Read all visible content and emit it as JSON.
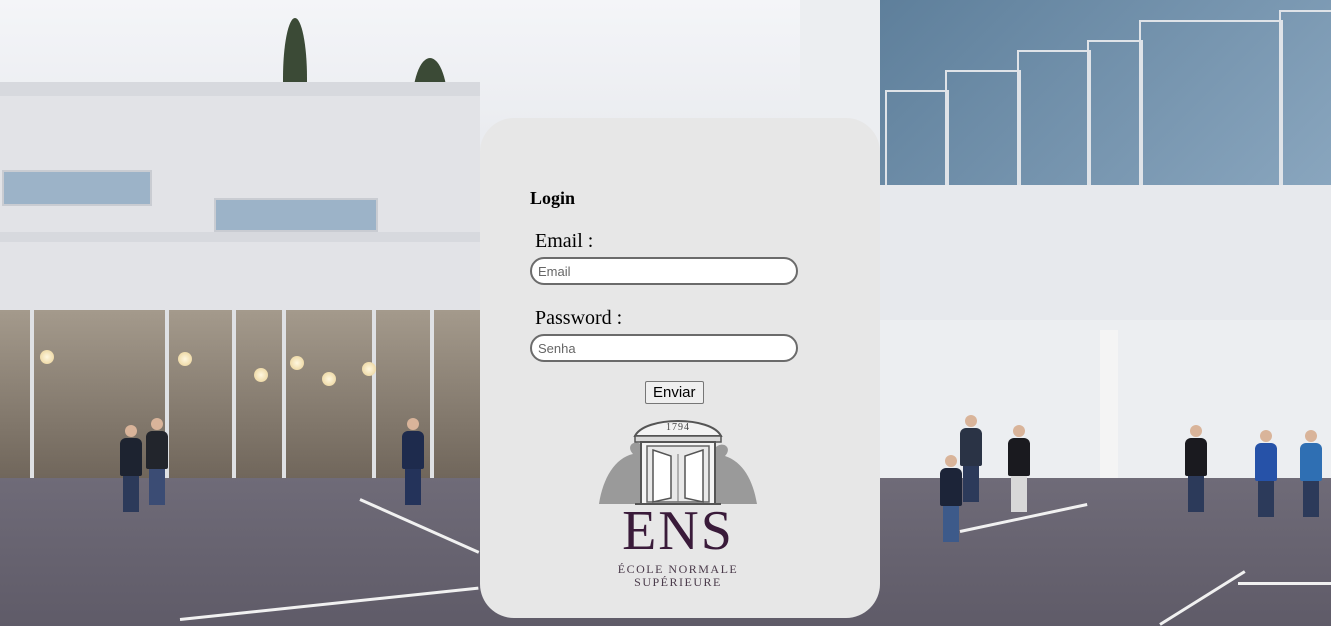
{
  "login": {
    "title": "Login",
    "email_label": "Email :",
    "email_placeholder": "Email",
    "password_label": "Password :",
    "password_placeholder": "Senha",
    "submit_label": "Enviar"
  },
  "logo": {
    "year": "1794",
    "acronym": "ENS",
    "line1": "ÉCOLE NORMALE",
    "line2": "SUPÉRIEURE"
  },
  "colors": {
    "card_background": "#e7e7e7",
    "logo_purple": "#3a1b3a"
  }
}
